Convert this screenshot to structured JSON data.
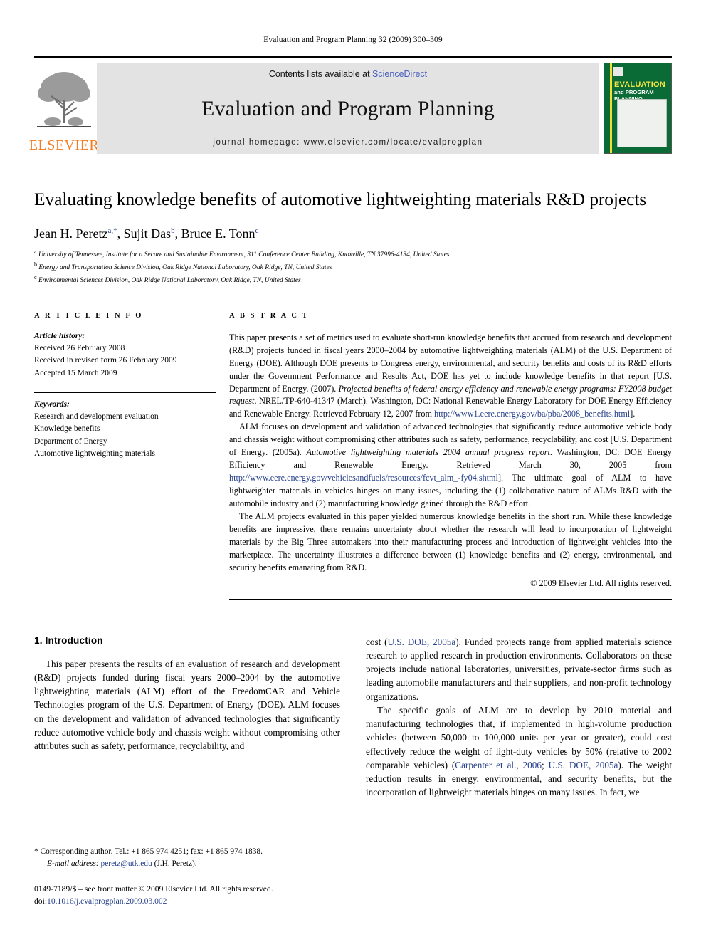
{
  "running_head": "Evaluation and Program Planning 32 (2009) 300–309",
  "masthead": {
    "contents_prefix": "Contents lists available at ",
    "sciencedirect": "ScienceDirect",
    "journal_title": "Evaluation and Program Planning",
    "homepage": "journal homepage: www.elsevier.com/locate/evalprogplan",
    "publisher": "ELSEVIER",
    "cover": {
      "line1": "EVALUATION",
      "line2": "and PROGRAM PLANNING",
      "bg_color": "#0b6b36",
      "accent_color": "#f0e130"
    }
  },
  "article": {
    "title": "Evaluating knowledge benefits of automotive lightweighting materials R&D projects",
    "authors_html": "Jean H. Peretz a,*, Sujit Das b, Bruce E. Tonn c",
    "affiliations": [
      "University of Tennessee, Institute for a Secure and Sustainable Environment, 311 Conference Center Building, Knoxville, TN 37996-4134, United States",
      "Energy and Transportation Science Division, Oak Ridge National Laboratory, Oak Ridge, TN, United States",
      "Environmental Sciences Division, Oak Ridge National Laboratory, Oak Ridge, TN, United States"
    ]
  },
  "article_info": {
    "heading": "A R T I C L E  I N F O",
    "history_label": "Article history:",
    "history": [
      "Received 26 February 2008",
      "Received in revised form 26 February 2009",
      "Accepted 15 March 2009"
    ],
    "keywords_label": "Keywords:",
    "keywords": [
      "Research and development evaluation",
      "Knowledge benefits",
      "Department of Energy",
      "Automotive lightweighting materials"
    ]
  },
  "abstract": {
    "heading": "A B S T R A C T",
    "paragraphs": [
      "This paper presents a set of metrics used to evaluate short-run knowledge benefits that accrued from research and development (R&D) projects funded in fiscal years 2000–2004 by automotive lightweighting materials (ALM) of the U.S. Department of Energy (DOE). Although DOE presents to Congress energy, environmental, and security benefits and costs of its R&D efforts under the Government Performance and Results Act, DOE has yet to include knowledge benefits in that report [U.S. Department of Energy. (2007). Projected benefits of federal energy efficiency and renewable energy programs: FY2008 budget request. NREL/TP-640-41347 (March). Washington, DC: National Renewable Energy Laboratory for DOE Energy Efficiency and Renewable Energy. Retrieved February 12, 2007 from http://www1.eere.energy.gov/ba/pba/2008_benefits.html].",
      "ALM focuses on development and validation of advanced technologies that significantly reduce automotive vehicle body and chassis weight without compromising other attributes such as safety, performance, recyclability, and cost [U.S. Department of Energy. (2005a). Automotive lightweighting materials 2004 annual progress report. Washington, DC: DOE Energy Efficiency and Renewable Energy. Retrieved March 30, 2005 from http://www.eere.energy.gov/vehiclesandfuels/resources/fcvt_alm_-fy04.shtml]. The ultimate goal of ALM to have lightweighter materials in vehicles hinges on many issues, including the (1) collaborative nature of ALMs R&D with the automobile industry and (2) manufacturing knowledge gained through the R&D effort.",
      "The ALM projects evaluated in this paper yielded numerous knowledge benefits in the short run. While these knowledge benefits are impressive, there remains uncertainty about whether the research will lead to incorporation of lightweight materials by the Big Three automakers into their manufacturing process and introduction of lightweight vehicles into the marketplace. The uncertainty illustrates a difference between (1) knowledge benefits and (2) energy, environmental, and security benefits emanating from R&D."
    ],
    "copyright": "© 2009 Elsevier Ltd. All rights reserved."
  },
  "introduction": {
    "heading": "1. Introduction",
    "left_paragraph": "This paper presents the results of an evaluation of research and development (R&D) projects funded during fiscal years 2000–2004 by the automotive lightweighting materials (ALM) effort of the FreedomCAR and Vehicle Technologies program of the U.S. Department of Energy (DOE). ALM focuses on the development and validation of advanced technologies that significantly reduce automotive vehicle body and chassis weight without compromising other attributes such as safety, performance, recyclability, and",
    "right_paragraph_1": "cost (U.S. DOE, 2005a). Funded projects range from applied materials science research to applied research in production environments. Collaborators on these projects include national laboratories, universities, private-sector firms such as leading automobile manufacturers and their suppliers, and non-profit technology organizations.",
    "right_paragraph_2": "The specific goals of ALM are to develop by 2010 material and manufacturing technologies that, if implemented in high-volume production vehicles (between 50,000 to 100,000 units per year or greater), could cost effectively reduce the weight of light-duty vehicles by 50% (relative to 2002 comparable vehicles) (Carpenter et al., 2006; U.S. DOE, 2005a). The weight reduction results in energy, environmental, and security benefits, but the incorporation of lightweight materials hinges on many issues. In fact, we"
  },
  "footnotes": {
    "corresponding": "* Corresponding author. Tel.: +1 865 974 4251; fax: +1 865 974 1838.",
    "email_label": "E-mail address:",
    "email": "peretz@utk.edu",
    "email_suffix": "(J.H. Peretz).",
    "issn_line": "0149-7189/$ – see front matter © 2009 Elsevier Ltd. All rights reserved.",
    "doi_label": "doi:",
    "doi": "10.1016/j.evalprogplan.2009.03.002"
  }
}
